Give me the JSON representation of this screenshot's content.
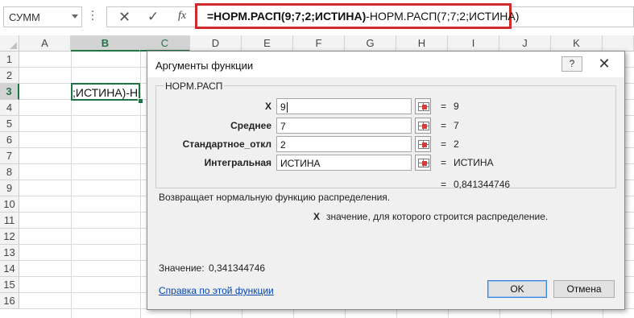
{
  "formula_bar": {
    "name_box": "СУММ",
    "cancel_glyph": "✕",
    "enter_glyph": "✓",
    "fx_label": "fx",
    "formula_bold": "=НОРМ.РАСП(9;7;2;ИСТИНА)",
    "formula_rest": "-НОРМ.РАСП(7;7;2;ИСТИНА)"
  },
  "sheet": {
    "columns": [
      "A",
      "B",
      "C",
      "D",
      "E",
      "F",
      "G",
      "H",
      "I",
      "J",
      "K"
    ],
    "rows": [
      "1",
      "2",
      "3",
      "4",
      "5",
      "6",
      "7",
      "8",
      "9",
      "10",
      "11",
      "12",
      "13",
      "14",
      "15",
      "16"
    ],
    "active_column": "B",
    "highlighted_column": "C",
    "active_row": "3",
    "active_cell_text": ";ИСТИНА)-НО"
  },
  "dialog": {
    "title": "Аргументы функции",
    "help_glyph": "?",
    "close_glyph": "✕",
    "function_name": "НОРМ.РАСП",
    "arguments": [
      {
        "label": "X",
        "value": "9",
        "result": "9"
      },
      {
        "label": "Среднее",
        "value": "7",
        "result": "7"
      },
      {
        "label": "Стандартное_откл",
        "value": "2",
        "result": "2"
      },
      {
        "label": "Интегральная",
        "value": "ИСТИНА",
        "result": "ИСТИНА"
      }
    ],
    "equals": "=",
    "function_result": "0,841344746",
    "description": "Возвращает нормальную функцию распределения.",
    "arg_desc_name": "X",
    "arg_desc_text": "значение, для которого строится распределение.",
    "value_label": "Значение:",
    "value_num": "0,341344746",
    "help_link": "Справка по этой функции",
    "ok_label": "OK",
    "cancel_label": "Отмена"
  },
  "colors": {
    "accent_green": "#217346",
    "formula_highlight": "#d02b2b",
    "link_blue": "#0645ad"
  }
}
